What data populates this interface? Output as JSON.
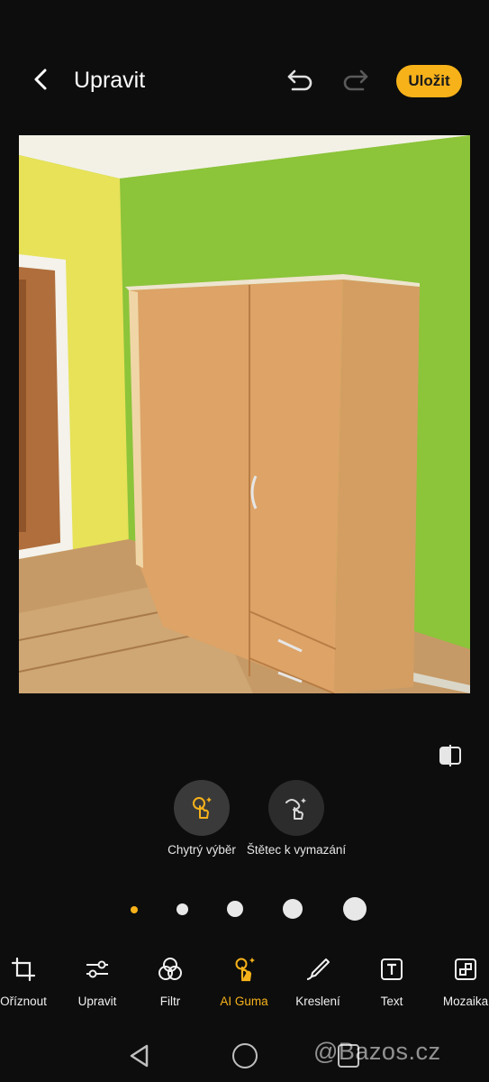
{
  "header": {
    "title": "Upravit",
    "save_label": "Uložit",
    "back_icon": "chevron-left-icon",
    "undo_icon": "undo-icon",
    "redo_icon": "redo-icon"
  },
  "photo": {
    "description_icon": "image"
  },
  "compare_icon": "compare-icon",
  "eraser_tools": [
    {
      "label": "Chytrý výběr",
      "icon": "smart-select-icon",
      "selected": true
    },
    {
      "label": "Štětec k vymazání",
      "icon": "brush-erase-icon",
      "selected": false
    }
  ],
  "brush_sizes": {
    "count": 5,
    "selected_index": 0
  },
  "toolbar": [
    {
      "label": "Oříznout",
      "icon": "crop-icon"
    },
    {
      "label": "Upravit",
      "icon": "sliders-icon"
    },
    {
      "label": "Filtr",
      "icon": "filter-icon"
    },
    {
      "label": "AI Guma",
      "icon": "ai-eraser-icon",
      "active": true
    },
    {
      "label": "Kreslení",
      "icon": "pen-icon"
    },
    {
      "label": "Text",
      "icon": "text-icon"
    },
    {
      "label": "Mozaika",
      "icon": "mosaic-icon"
    }
  ],
  "watermark": "@Bazos.cz",
  "colors": {
    "accent": "#f7b21a",
    "background": "#0d0d0d"
  }
}
